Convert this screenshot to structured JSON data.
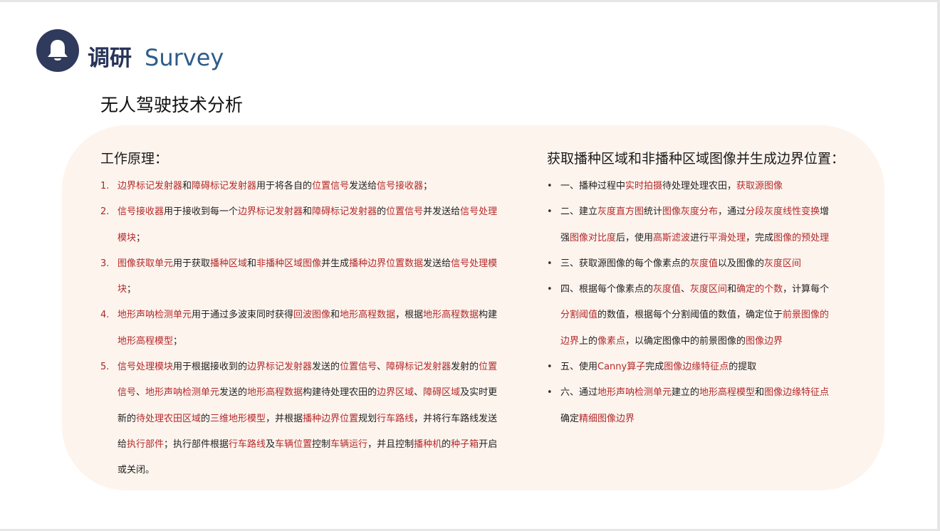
{
  "header": {
    "title_cn": "调研",
    "title_en": "Survey",
    "icon": "bell-icon",
    "icon_bg_color": "#2f3a5c"
  },
  "subtitle": "无人驾驶技术分析",
  "colors": {
    "highlight": "#b32a2a",
    "panel_bg": "#fdf4ee",
    "title_cn": "#27345a",
    "title_en": "#2d5c8a"
  },
  "left": {
    "heading": "工作原理：",
    "items": [
      {
        "marker": "1.",
        "segments": [
          {
            "t": "边界标记发射器",
            "h": true
          },
          {
            "t": "和",
            "h": false
          },
          {
            "t": "障碍标记发射器",
            "h": true
          },
          {
            "t": "用于将各自的",
            "h": false
          },
          {
            "t": "位置信号",
            "h": true
          },
          {
            "t": "发送给",
            "h": false
          },
          {
            "t": "信号接收器",
            "h": true
          },
          {
            "t": "；",
            "h": false
          }
        ]
      },
      {
        "marker": "2.",
        "segments": [
          {
            "t": "信号接收器",
            "h": true
          },
          {
            "t": "用于接收到每一个",
            "h": false
          },
          {
            "t": "边界标记发射器",
            "h": true
          },
          {
            "t": "和",
            "h": false
          },
          {
            "t": "障碍标记发射器",
            "h": true
          },
          {
            "t": "的",
            "h": false
          },
          {
            "t": "位置信号",
            "h": true
          },
          {
            "t": "并发送给",
            "h": false
          },
          {
            "t": "信号处理模块",
            "h": true
          },
          {
            "t": "；",
            "h": false
          }
        ]
      },
      {
        "marker": "3.",
        "segments": [
          {
            "t": "图像获取单元",
            "h": true
          },
          {
            "t": "用于获取",
            "h": false
          },
          {
            "t": "播种区域",
            "h": true
          },
          {
            "t": "和",
            "h": false
          },
          {
            "t": "非播种区域图像",
            "h": true
          },
          {
            "t": "并生成",
            "h": false
          },
          {
            "t": "播种边界位置数据",
            "h": true
          },
          {
            "t": "发送给",
            "h": false
          },
          {
            "t": "信号处理模块",
            "h": true
          },
          {
            "t": "；",
            "h": false
          }
        ]
      },
      {
        "marker": "4.",
        "segments": [
          {
            "t": "地形声呐检测单元",
            "h": true
          },
          {
            "t": "用于通过多波束同时获得",
            "h": false
          },
          {
            "t": "回波图像",
            "h": true
          },
          {
            "t": "和",
            "h": false
          },
          {
            "t": "地形高程数据",
            "h": true
          },
          {
            "t": "，根据",
            "h": false
          },
          {
            "t": "地形高程数据",
            "h": true
          },
          {
            "t": "构建",
            "h": false
          },
          {
            "t": "地形高程模型",
            "h": true
          },
          {
            "t": "；",
            "h": false
          }
        ]
      },
      {
        "marker": "5.",
        "segments": [
          {
            "t": "信号处理模块",
            "h": true
          },
          {
            "t": "用于根据接收到的",
            "h": false
          },
          {
            "t": "边界标记发射器",
            "h": true
          },
          {
            "t": "发送的",
            "h": false
          },
          {
            "t": "位置信号",
            "h": true
          },
          {
            "t": "、",
            "h": false
          },
          {
            "t": "障碍标记发射器",
            "h": true
          },
          {
            "t": "发射的",
            "h": false
          },
          {
            "t": "位置信号",
            "h": true
          },
          {
            "t": "、",
            "h": false
          },
          {
            "t": "地形声呐检测单元",
            "h": true
          },
          {
            "t": "发送的",
            "h": false
          },
          {
            "t": "地形高程数据",
            "h": true
          },
          {
            "t": "构建待处理农田的",
            "h": false
          },
          {
            "t": "边界区域",
            "h": true
          },
          {
            "t": "、",
            "h": false
          },
          {
            "t": "障碍区域",
            "h": true
          },
          {
            "t": "及实时更新的",
            "h": false
          },
          {
            "t": "待处理农田区域",
            "h": true
          },
          {
            "t": "的",
            "h": false
          },
          {
            "t": "三维地形模型",
            "h": true
          },
          {
            "t": "，并根据",
            "h": false
          },
          {
            "t": "播种边界位置",
            "h": true
          },
          {
            "t": "规划",
            "h": false
          },
          {
            "t": "行车路线",
            "h": true
          },
          {
            "t": "，并将行车路线发送给",
            "h": false
          },
          {
            "t": "执行部件",
            "h": true
          },
          {
            "t": "；执行部件根据",
            "h": false
          },
          {
            "t": "行车路线",
            "h": true
          },
          {
            "t": "及",
            "h": false
          },
          {
            "t": "车辆位置",
            "h": true
          },
          {
            "t": "控制",
            "h": false
          },
          {
            "t": "车辆运行",
            "h": true
          },
          {
            "t": "，并且控制",
            "h": false
          },
          {
            "t": "播种机",
            "h": true
          },
          {
            "t": "的",
            "h": false
          },
          {
            "t": "种子箱",
            "h": true
          },
          {
            "t": "开启或关闭。",
            "h": false
          }
        ]
      }
    ]
  },
  "right": {
    "heading": "获取播种区域和非播种区域图像并生成边界位置：",
    "items": [
      {
        "marker": "•",
        "segments": [
          {
            "t": "一、播种过程中",
            "h": false
          },
          {
            "t": "实时拍摄",
            "h": true
          },
          {
            "t": "待处理处理农田，",
            "h": false
          },
          {
            "t": "获取源图像",
            "h": true
          }
        ]
      },
      {
        "marker": "•",
        "segments": [
          {
            "t": "二、建立",
            "h": false
          },
          {
            "t": "灰度直方图",
            "h": true
          },
          {
            "t": "统计",
            "h": false
          },
          {
            "t": "图像灰度分布",
            "h": true
          },
          {
            "t": "，通过",
            "h": false
          },
          {
            "t": "分段灰度线性变换",
            "h": true
          },
          {
            "t": "增强",
            "h": false
          },
          {
            "t": "图像对比度",
            "h": true
          },
          {
            "t": "后，使用",
            "h": false
          },
          {
            "t": "高斯滤波",
            "h": true
          },
          {
            "t": "进行",
            "h": false
          },
          {
            "t": "平滑处理",
            "h": true
          },
          {
            "t": "，完成",
            "h": false
          },
          {
            "t": "图像的预处理",
            "h": true
          }
        ]
      },
      {
        "marker": "•",
        "segments": [
          {
            "t": "三、获取源图像的每个像素点的",
            "h": false
          },
          {
            "t": "灰度值",
            "h": true
          },
          {
            "t": "以及图像的",
            "h": false
          },
          {
            "t": "灰度区间",
            "h": true
          }
        ]
      },
      {
        "marker": "•",
        "segments": [
          {
            "t": "四、根据每个像素点的",
            "h": false
          },
          {
            "t": "灰度值",
            "h": true
          },
          {
            "t": "、",
            "h": false
          },
          {
            "t": "灰度区间",
            "h": true
          },
          {
            "t": "和",
            "h": false
          },
          {
            "t": "确定的个数",
            "h": true
          },
          {
            "t": "，计算每个",
            "h": false
          },
          {
            "t": "分割阈值",
            "h": true
          },
          {
            "t": "的数值，根据每个分割阈值的数值，确定位于",
            "h": false
          },
          {
            "t": "前景图像的边界",
            "h": true
          },
          {
            "t": "上的",
            "h": false
          },
          {
            "t": "像素点",
            "h": true
          },
          {
            "t": "，以确定图像中的前景图像的",
            "h": false
          },
          {
            "t": "图像边界",
            "h": true
          }
        ]
      },
      {
        "marker": "•",
        "segments": [
          {
            "t": "五、使用",
            "h": false
          },
          {
            "t": "Canny算子",
            "h": true
          },
          {
            "t": "完成",
            "h": false
          },
          {
            "t": "图像边缘特征点",
            "h": true
          },
          {
            "t": "的提取",
            "h": false
          }
        ]
      },
      {
        "marker": "•",
        "segments": [
          {
            "t": "六、通过",
            "h": false
          },
          {
            "t": "地形声呐检测单元",
            "h": true
          },
          {
            "t": "建立的",
            "h": false
          },
          {
            "t": "地形高程模型",
            "h": true
          },
          {
            "t": "和",
            "h": false
          },
          {
            "t": "图像边缘特征点",
            "h": true
          },
          {
            "t": "确定",
            "h": false
          },
          {
            "t": "精细图像边界",
            "h": true
          }
        ]
      }
    ]
  }
}
